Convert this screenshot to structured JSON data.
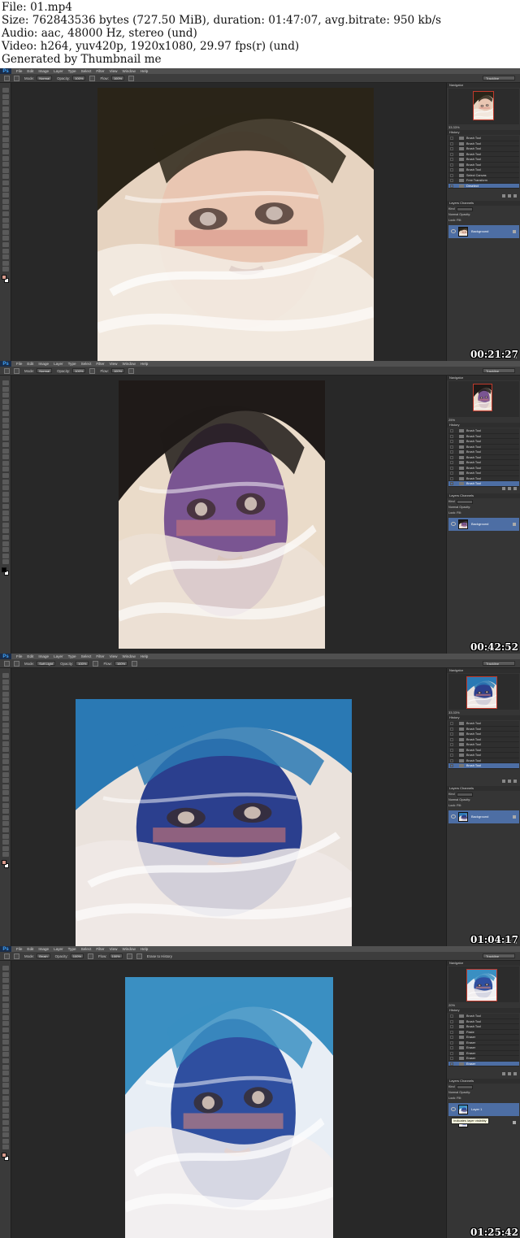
{
  "header": {
    "line1": "File: 01.mp4",
    "line2": "Size: 762843536 bytes (727.50 MiB), duration: 01:47:07, avg.bitrate: 950 kb/s",
    "line3": "Audio: aac, 48000 Hz, stereo (und)",
    "line4": "Video: h264, yuv420p, 1920x1080, 29.97 fps(r) (und)",
    "line5": "Generated by Thumbnail me"
  },
  "app": {
    "logo": "Ps",
    "menus": [
      "File",
      "Edit",
      "Image",
      "Layer",
      "Type",
      "Select",
      "Filter",
      "View",
      "Window",
      "Help"
    ],
    "workspace": "Trackline"
  },
  "panels": {
    "navigator_tab": "Navigator",
    "history_tab": "History",
    "layers_tab": "Layers",
    "channels_tab": "Channels",
    "lock_label": "Lock:",
    "opacity_label": "Opacity:",
    "fill_label": "Fill:",
    "blend_mode": "Normal",
    "kind_label": "Kind"
  },
  "frames": [
    {
      "timestamp": "00:21:27",
      "mode": "Normal",
      "opacity": "100%",
      "flow": "100%",
      "zoom": "33.33%",
      "history": [
        "Brush Tool",
        "Brush Tool",
        "Brush Tool",
        "Brush Tool",
        "Brush Tool",
        "Brush Tool",
        "Brush Tool",
        "Select Canvas",
        "Free Transform",
        "Deselect"
      ],
      "history_active": 9,
      "layers": [
        {
          "name": "Background",
          "active": true
        }
      ]
    },
    {
      "timestamp": "00:42:52",
      "mode": "Normal",
      "opacity": "100%",
      "flow": "100%",
      "zoom": "25%",
      "history": [
        "Brush Tool",
        "Brush Tool",
        "Brush Tool",
        "Brush Tool",
        "Brush Tool",
        "Brush Tool",
        "Brush Tool",
        "Brush Tool",
        "Brush Tool",
        "Brush Tool",
        "Brush Tool"
      ],
      "history_active": 10,
      "layers": [
        {
          "name": "Background",
          "active": true
        }
      ]
    },
    {
      "timestamp": "01:04:17",
      "mode": "Soft Light",
      "opacity": "100%",
      "flow": "100%",
      "zoom": "33.33%",
      "history": [
        "Brush Tool",
        "Brush Tool",
        "Brush Tool",
        "Brush Tool",
        "Brush Tool",
        "Brush Tool",
        "Brush Tool",
        "Brush Tool",
        "Brush Tool"
      ],
      "history_active": 8,
      "layers": [
        {
          "name": "Background",
          "active": true
        }
      ]
    },
    {
      "timestamp": "01:25:42",
      "mode": "Brush",
      "opacity": "100%",
      "flow": "100%",
      "zoom": "20%",
      "erase_history": "Erase to History",
      "history": [
        "Brush Tool",
        "Brush Tool",
        "Brush Tool",
        "Paste",
        "Eraser",
        "Eraser",
        "Eraser",
        "Eraser",
        "Eraser",
        "Eraser"
      ],
      "history_active": 9,
      "layers": [
        {
          "name": "Layer 1",
          "active": true
        },
        {
          "name": "Background",
          "active": false
        }
      ],
      "tooltip": "Indicates layer visibility"
    }
  ],
  "colors": {
    "ui_dark": "#282828",
    "panel": "#353535",
    "selection": "#4d6ea4"
  }
}
